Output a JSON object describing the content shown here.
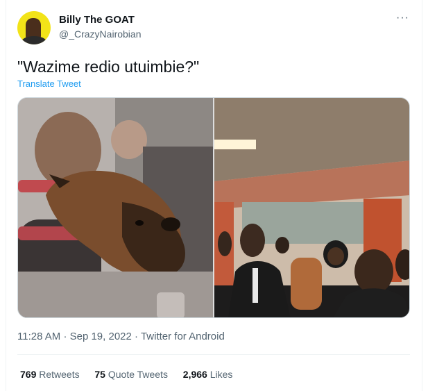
{
  "tweet": {
    "author": {
      "display_name": "Billy The GOAT",
      "handle": "@_CrazyNairobian",
      "avatar_icon": "profile-avatar"
    },
    "more_icon": "more-horizontal-icon",
    "text": "\"Wazime redio utuimbie?\"",
    "translate_label": "Translate Tweet",
    "media": [
      {
        "description_icon": "dog-on-airplane-photo"
      },
      {
        "description_icon": "people-on-bus-photo"
      }
    ],
    "meta": {
      "time": "11:28 AM",
      "separator": "·",
      "date": "Sep 19, 2022",
      "source": "Twitter for Android"
    },
    "stats": [
      {
        "count": "769",
        "label": "Retweets"
      },
      {
        "count": "75",
        "label": "Quote Tweets"
      },
      {
        "count": "2,966",
        "label": "Likes"
      }
    ]
  },
  "colors": {
    "text_primary": "#0f1419",
    "text_secondary": "#536471",
    "link": "#1d9bf0",
    "border": "#eff3f4"
  }
}
